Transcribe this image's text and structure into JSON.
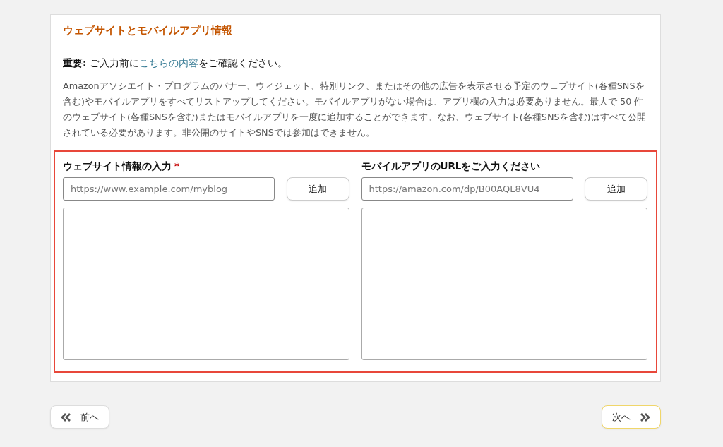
{
  "card": {
    "title": "ウェブサイトとモバイルアプリ情報"
  },
  "notice": {
    "lead": "**重要:** ご入力前に",
    "link": "こちらの内容",
    "tail": "をご確認ください。"
  },
  "description": "Amazonアソシエイト・プログラムのバナー、ウィジェット、特別リンク、またはその他の広告を表示させる予定のウェブサイト(各種SNSを含む)やモバイルアプリをすべてリストアップしてください。モバイルアプリがない場合は、アプリ欄の入力は必要ありません。最大で 50 件のウェブサイト(各種SNSを含む)またはモバイルアプリを一度に追加することができます。なお、ウェブサイト(各種SNSを含む)はすべて公開されている必要があります。非公開のサイトやSNSでは参加はできません。",
  "sections": [
    {
      "label": "ウェブサイト情報の入力",
      "required_mark": "*",
      "placeholder": "https://www.example.com/myblog",
      "button": "追加"
    },
    {
      "label": "モバイルアプリのURLをご入力ください",
      "placeholder": "https://amazon.com/dp/B00AQL8VU4",
      "button": "追加"
    }
  ],
  "nav": {
    "prev": "前へ",
    "next": "次へ"
  }
}
